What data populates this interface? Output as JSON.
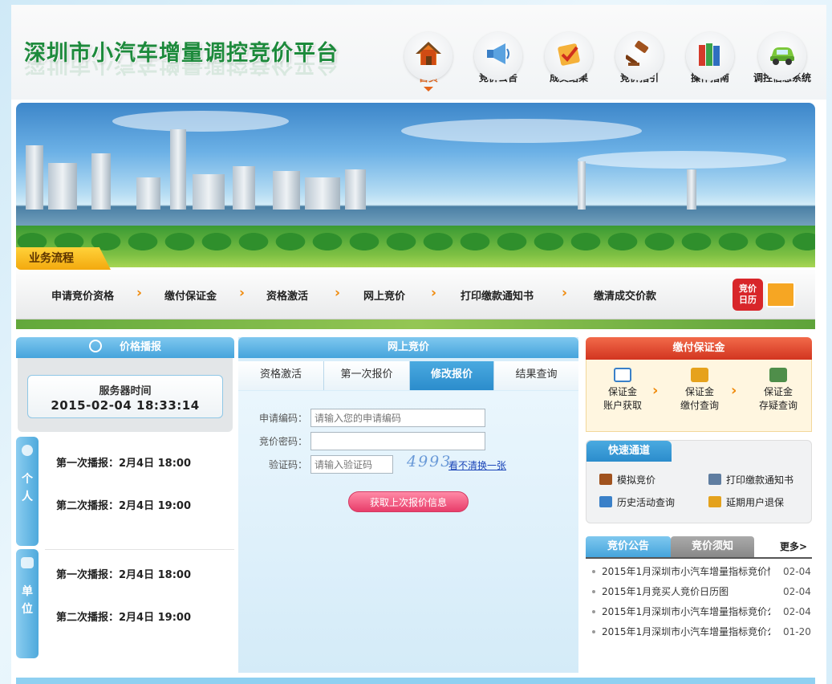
{
  "header": {
    "site_title": "深圳市小汽车增量调控竞价平台",
    "nav": [
      {
        "label": "首页",
        "icon": "home-icon",
        "active": true
      },
      {
        "label": "竞价公告",
        "icon": "megaphone-icon"
      },
      {
        "label": "成交结果",
        "icon": "checkmark-icon"
      },
      {
        "label": "竞价指引",
        "icon": "gavel-icon"
      },
      {
        "label": "操作指南",
        "icon": "books-icon"
      },
      {
        "label": "调控信息系统",
        "icon": "car-icon"
      }
    ]
  },
  "flow": {
    "tab_label": "业务流程",
    "steps": [
      "申请竞价资格",
      "缴付保证金",
      "资格激活",
      "网上竞价",
      "打印缴款通知书",
      "缴清成交价款"
    ],
    "calendar_label_1": "竞价",
    "calendar_label_2": "日历"
  },
  "price_broadcast": {
    "title": "价格播报",
    "server_time_label": "服务器时间",
    "server_time": "2015-02-04 18:33:14",
    "personal": {
      "tab_chars": [
        "个",
        "人"
      ],
      "items": [
        "第一次播报：2月4日 18:00",
        "第二次播报：2月4日 19:00"
      ]
    },
    "company": {
      "tab_chars": [
        "单",
        "位"
      ],
      "items": [
        "第一次播报：2月4日 18:00",
        "第二次播报：2月4日 19:00"
      ]
    }
  },
  "online_bid": {
    "title": "网上竞价",
    "tabs": [
      "资格激活",
      "第一次报价",
      "修改报价",
      "结果查询"
    ],
    "active_tab": 2,
    "form": {
      "app_code_label": "申请编码：",
      "app_code_placeholder": "请输入您的申请编码",
      "password_label": "竞价密码：",
      "captcha_label": "验证码：",
      "captcha_placeholder": "请输入验证码",
      "captcha_image_text": "4993",
      "captcha_refresh": "看不清换一张",
      "submit_label": "获取上次报价信息"
    }
  },
  "deposit": {
    "title": "缴付保证金",
    "items": [
      {
        "line1": "保证金",
        "line2": "账户获取"
      },
      {
        "line1": "保证金",
        "line2": "缴付查询"
      },
      {
        "line1": "保证金",
        "line2": "存疑查询"
      }
    ]
  },
  "quick": {
    "title": "快速通道",
    "links": [
      "模拟竞价",
      "打印缴款通知书",
      "历史活动查询",
      "延期用户退保"
    ]
  },
  "news": {
    "tabs": [
      "竞价公告",
      "竞价须知"
    ],
    "more": "更多>",
    "items": [
      {
        "title": "2015年1月深圳市小汽车增量指标竞价情",
        "date": "02-04"
      },
      {
        "title": "2015年1月竞买人竞价日历图",
        "date": "02-04"
      },
      {
        "title": "2015年1月深圳市小汽车增量指标竞价公",
        "date": "02-04"
      },
      {
        "title": "2015年1月深圳市小汽车增量指标竞价公",
        "date": "01-20"
      }
    ]
  },
  "colors": {
    "accent_blue": "#2b8ccc",
    "accent_orange": "#f08a0b",
    "deposit_red": "#d23520",
    "title_green": "#1d8a3c"
  }
}
